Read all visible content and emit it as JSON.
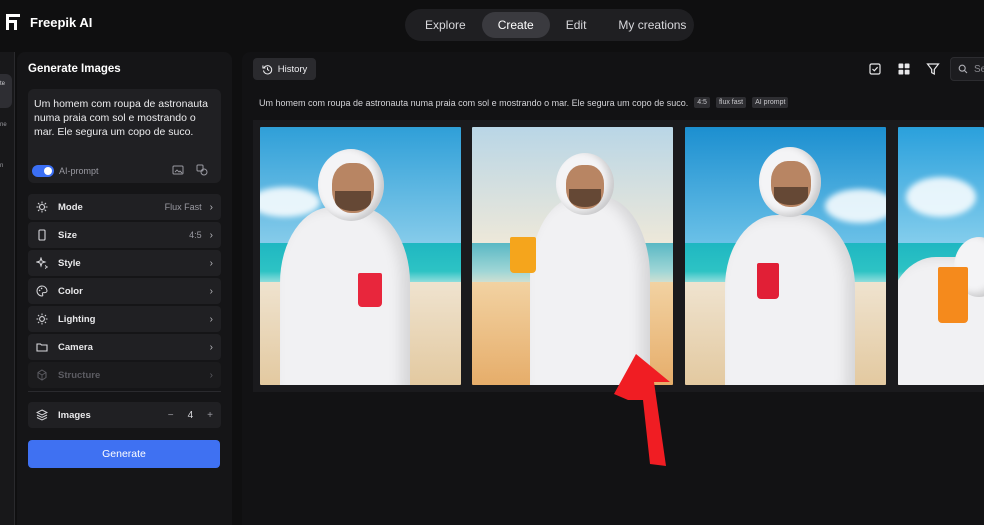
{
  "app": {
    "title": "Freepik AI"
  },
  "topnav": {
    "tabs": [
      "Explore",
      "Create",
      "Edit",
      "My creations"
    ],
    "active": "Create"
  },
  "rail": {
    "items": [
      "te",
      "ne",
      "n"
    ]
  },
  "panel": {
    "title": "Generate Images",
    "prompt": "Um homem com roupa de astronauta numa praia com sol e mostrando o mar. Ele segura um copo de suco.",
    "ai_prompt_label": "AI-prompt",
    "ai_prompt_enabled": true,
    "options": [
      {
        "label": "Mode",
        "value": "Flux Fast",
        "icon": "sparkle-gear-icon"
      },
      {
        "label": "Size",
        "value": "4:5",
        "icon": "phone-frame-icon"
      },
      {
        "label": "Style",
        "value": "",
        "icon": "magic-stars-icon"
      },
      {
        "label": "Color",
        "value": "",
        "icon": "palette-icon"
      },
      {
        "label": "Lighting",
        "value": "",
        "icon": "sun-icon"
      },
      {
        "label": "Camera",
        "value": "",
        "icon": "folder-icon"
      },
      {
        "label": "Structure",
        "value": "",
        "icon": "structure-icon"
      }
    ],
    "images": {
      "label": "Images",
      "minus": "−",
      "count": "4",
      "plus": "+"
    },
    "generate_label": "Generate"
  },
  "main": {
    "history_label": "History",
    "search_placeholder": "Se",
    "generation": {
      "prompt": "Um homem com roupa de astronauta numa praia com sol e mostrando o mar. Ele segura um copo de suco.",
      "tags": [
        "4:5",
        "flux fast",
        "AI prompt"
      ]
    },
    "images_count": 4
  },
  "colors": {
    "accent": "#3f71f2",
    "annotation_arrow": "#f01d23",
    "background": "#0f0f10"
  }
}
